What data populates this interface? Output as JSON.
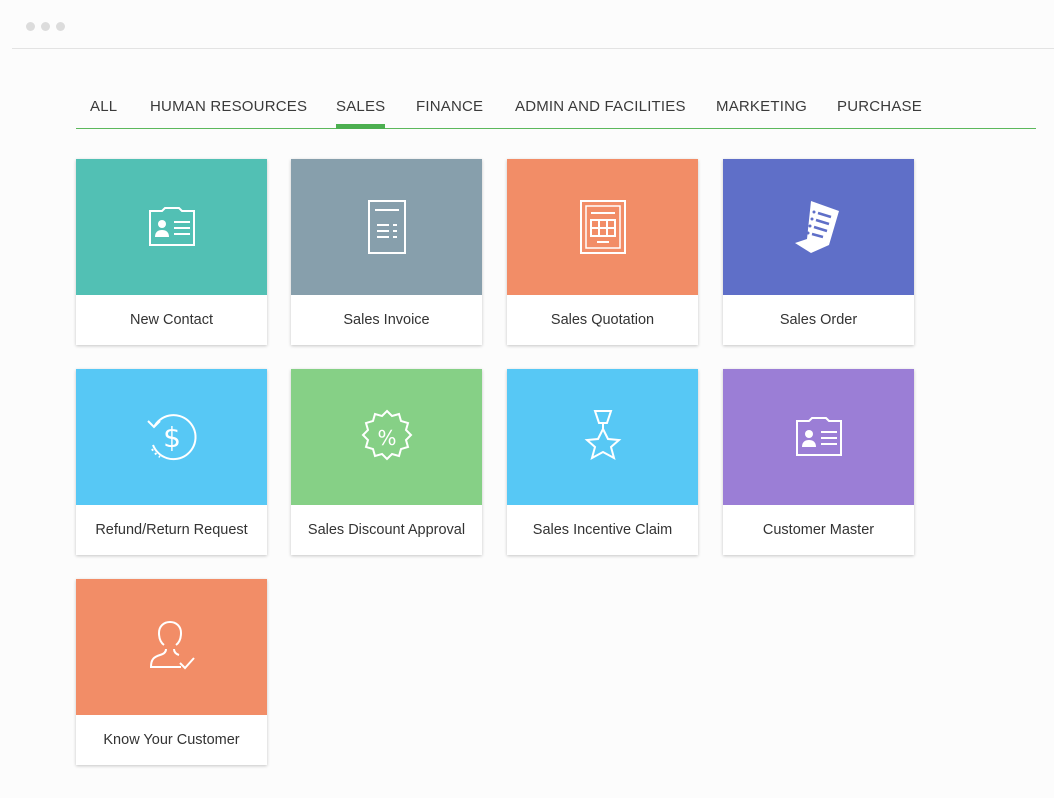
{
  "tabs": [
    {
      "label": "ALL"
    },
    {
      "label": "HUMAN RESOURCES"
    },
    {
      "label": "SALES"
    },
    {
      "label": "FINANCE"
    },
    {
      "label": "ADMIN AND FACILITIES"
    },
    {
      "label": "MARKETING"
    },
    {
      "label": "PURCHASE"
    }
  ],
  "active_tab": "SALES",
  "colors": {
    "accent": "#4caf50",
    "teal": "#52c0b4",
    "slate": "#879fac",
    "coral": "#f28d67",
    "indigo": "#5f6fc8",
    "sky": "#57c8f5",
    "green": "#86d086",
    "purple": "#9b7ed6"
  },
  "cards": [
    {
      "label": "New Contact",
      "icon": "contact-card-icon",
      "color": "#52c0b4"
    },
    {
      "label": "Sales Invoice",
      "icon": "invoice-document-icon",
      "color": "#879fac"
    },
    {
      "label": "Sales Quotation",
      "icon": "quotation-document-icon",
      "color": "#f28d67"
    },
    {
      "label": "Sales Order",
      "icon": "order-scroll-icon",
      "color": "#5f6fc8"
    },
    {
      "label": "Refund/Return Request",
      "icon": "refund-dollar-icon",
      "color": "#57c8f5"
    },
    {
      "label": "Sales Discount Approval",
      "icon": "discount-badge-icon",
      "color": "#86d086"
    },
    {
      "label": "Sales Incentive Claim",
      "icon": "medal-star-icon",
      "color": "#57c8f5"
    },
    {
      "label": "Customer Master",
      "icon": "customer-card-icon",
      "color": "#9b7ed6"
    },
    {
      "label": "Know Your Customer",
      "icon": "user-check-icon",
      "color": "#f28d67"
    }
  ]
}
